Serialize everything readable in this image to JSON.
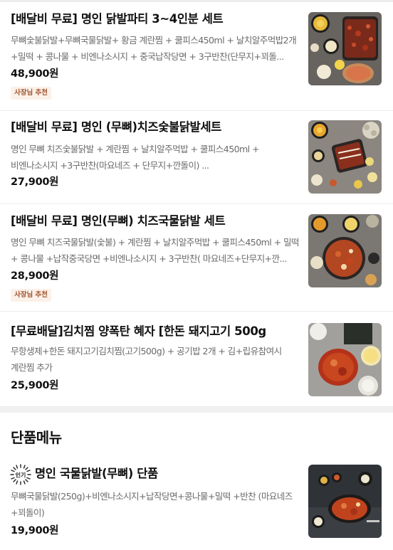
{
  "menu": {
    "items": [
      {
        "tag": "[배달비 무료]",
        "name": "명인 닭발파티 3~4인분 세트",
        "description": "무뼈숯불닭발+무뼈국물닭발+ 황금 계란찜  + 쿨피스450ml  + 날치알주먹밥2개 +밀떡 + 콩나물 + 비엔나소시지 + 중국납작당면 + 3구반찬(단무지+꾀돌...",
        "price": "48,900원",
        "badge": "사장님 추천"
      },
      {
        "tag": "[배달비 무료]",
        "name": "명인 (무뼈)치즈숯불닭발세트",
        "description": "명인 무뼈 치즈숯불닭발 + 계란찜 + 날치알주먹밥 +  쿨피스450ml + 비엔나소시지 +3구반찬(마요네즈 + 단무지+깐돌이) ...",
        "price": "27,900원",
        "badge": ""
      },
      {
        "tag": "[배달비 무료]",
        "name": "명인(무뼈) 치즈국물닭발 세트",
        "description": "명인 무뼈 치즈국물닭발(숯불) + 계란찜 + 날치알주먹밥 + 쿨피스450ml + 밀떡 + 콩나물 +납작중국당면 +비엔나소시지 + 3구반찬( 마요네즈+단무지+깐...",
        "price": "28,900원",
        "badge": "사장님 추천"
      },
      {
        "tag": "",
        "name": "[무료배달]김치찜 양폭탄 혜자 [한돈 돼지고기 500g",
        "description": "무항생제+한돈 돼지고기김치찜(고기500g) +   공기밥 2개 + 김+립유참여시 계란찜 추가",
        "price": "25,900원",
        "badge": ""
      }
    ]
  },
  "single_section": {
    "title": "단품메뉴",
    "items": [
      {
        "popular_label": "인기",
        "name": "명인 국물닭발(무뼈) 단품",
        "description": "무뼈국물닭발(250g)+비엔나소시지+납작당면+콩나물+밀떡 +반찬 (마요네즈+꾀돌이)",
        "price": "19,900원"
      }
    ]
  }
}
